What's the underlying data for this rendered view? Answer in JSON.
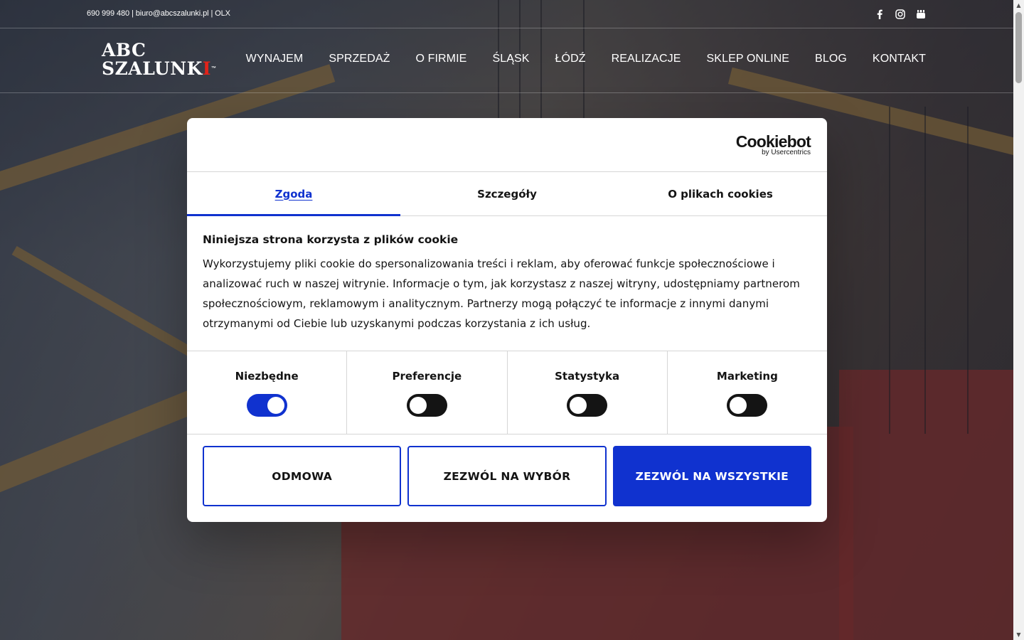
{
  "topbar": {
    "phone": "690 999 480",
    "separator1": " | ",
    "email": "biuro@abcszalunki.pl",
    "separator2": " | ",
    "olx": "OLX",
    "social_icons": [
      "facebook-icon",
      "instagram-icon",
      "youtube-icon"
    ]
  },
  "header": {
    "logo_line1": "ABC",
    "logo_line2_main": "SZALUNK",
    "logo_line2_accent": "I",
    "logo_tm": "™",
    "nav": [
      {
        "label": "WYNAJEM"
      },
      {
        "label": "SPRZEDAŻ"
      },
      {
        "label": "O FIRMIE"
      },
      {
        "label": "ŚLĄSK"
      },
      {
        "label": "ŁÓDŹ"
      },
      {
        "label": "REALIZACJE"
      },
      {
        "label": "SKLEP ONLINE"
      },
      {
        "label": "BLOG"
      },
      {
        "label": "KONTAKT"
      }
    ]
  },
  "cookie_dialog": {
    "brand": "Cookiebot",
    "brand_sub": "by Usercentrics",
    "tabs": [
      {
        "label": "Zgoda",
        "active": true
      },
      {
        "label": "Szczegóły",
        "active": false
      },
      {
        "label": "O plikach cookies",
        "active": false
      }
    ],
    "heading": "Niniejsza strona korzysta z plików cookie",
    "text": "Wykorzystujemy pliki cookie do spersonalizowania treści i reklam, aby oferować funkcje społecznościowe i analizować ruch w naszej witrynie. Informacje o tym, jak korzystasz z naszej witryny, udostępniamy partnerom społecznościowym, reklamowym i analitycznym. Partnerzy mogą połączyć te informacje z innymi danymi otrzymanymi od Ciebie lub uzyskanymi podczas korzystania z ich usług.",
    "categories": [
      {
        "label": "Niezbędne",
        "enabled": true
      },
      {
        "label": "Preferencje",
        "enabled": false
      },
      {
        "label": "Statystyka",
        "enabled": false
      },
      {
        "label": "Marketing",
        "enabled": false
      }
    ],
    "buttons": {
      "deny": "ODMOWA",
      "allow_selection": "ZEZWÓL NA WYBÓR",
      "allow_all": "ZEZWÓL NA WSZYSTKIE"
    }
  },
  "colors": {
    "accent": "#1032cf",
    "logo_red": "#e2231a",
    "text": "#141414"
  }
}
